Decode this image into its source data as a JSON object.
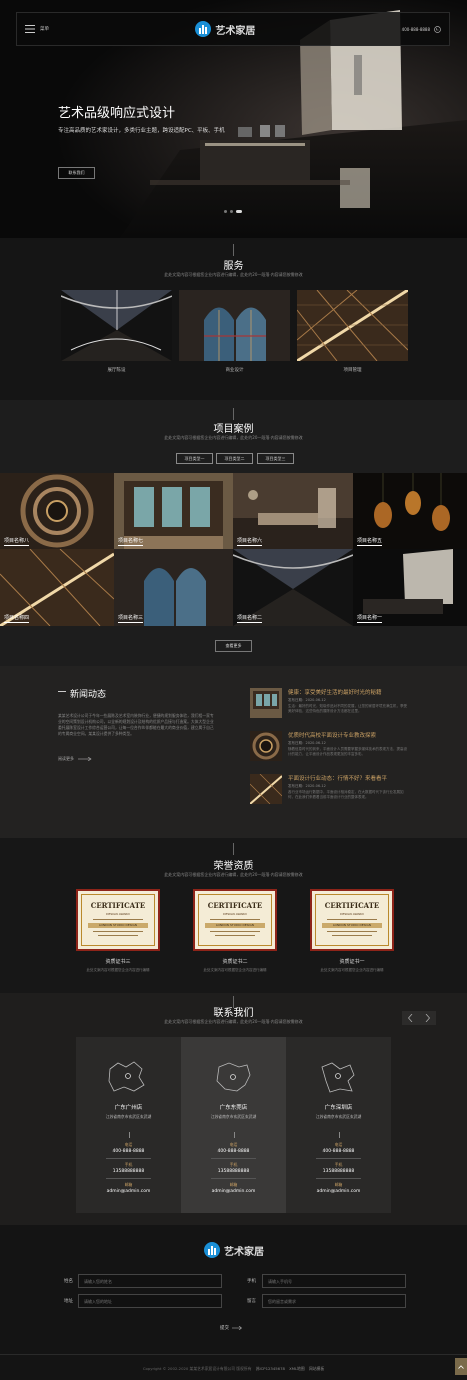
{
  "header": {
    "menu_label": "菜单",
    "brand": "艺术家居",
    "phone": "400-888-8888"
  },
  "hero": {
    "title": "艺术品级响应式设计",
    "subtitle": "专注高品质的艺术家设计，多类行业主题，跨设适配PC、平板、手机",
    "button": "联系我们"
  },
  "services": {
    "title": "服务",
    "subtitle": "此处文案内容可根据您企业内容进行编辑，此处约20一段落·内容请您按需修改",
    "items": [
      {
        "label": "展厅陈设"
      },
      {
        "label": "商业设计"
      },
      {
        "label": "项目管理"
      }
    ]
  },
  "cases": {
    "title": "项目案例",
    "subtitle": "此处文案内容可根据您企业内容进行编辑，此处约20一段落·内容请您按需修改",
    "filters": [
      "项目类型一",
      "项目类型二",
      "项目类型三"
    ],
    "tiles": [
      "项目名称八",
      "项目名称七",
      "项目名称六",
      "项目名称五",
      "项目名称四",
      "项目名称三",
      "项目名称二",
      "项目名称一"
    ],
    "more": "查看更多"
  },
  "news": {
    "title": "新闻动态",
    "intro": "某某艺术设计公司于今年一些展陈及艺术室内装饰行业，便捷的规划服务体验，我们相一家专业的空间策划设计机构公司，以全新的规划设计及结构的优质产品接与打造案。大体大型企业委托展陈室设计工作综合运营公司，让每一位合作伙伴都能在最大的商业价值，建立属于自己的专属商业空间。某某设计提供了多种类型。",
    "more": "阅读更多",
    "items": [
      {
        "title": "健康：享受美好生活的最好时光的秘籍",
        "date": "发布日期：2020-06-12",
        "desc": "生活：最好的时光，知晓作品对不同的发展，让您的家居环境充满生机，享受美好体验，这些特色的展陈设计方法都在这里。"
      },
      {
        "title": "优质时代高校平面设计专业教改探索",
        "date": "发布日期：2020-06-12",
        "desc": "随着信息时代的到来，平面设计人员需要掌握多媒体技术的表现方法，提高设计的能力，让平面设计作品表现更加的丰富多彩。"
      },
      {
        "title": "平面设计行业动态：行情不好？来看看平",
        "date": "发布日期：2020-06-12",
        "desc": "各行业市场运行数据中，平面设计相对稳定，在大数据时代下该行业发展如何，在此我们来看看当前平面设计行业的整体表现。"
      }
    ]
  },
  "honors": {
    "title": "荣誉资质",
    "subtitle": "此处文案内容可根据您企业内容进行编辑，此处约20一段落·内容请您按需修改",
    "cert_heading": "CERTIFICATE",
    "cert_small": "DESIGN AWARD",
    "cert_band": "LONDON STUDIO DESIGN",
    "items": [
      {
        "label": "资质证书三",
        "desc": "此处文案内容可根据您企业内容进行编辑"
      },
      {
        "label": "资质证书二",
        "desc": "此处文案内容可根据您企业内容进行编辑"
      },
      {
        "label": "资质证书一",
        "desc": "此处文案内容可根据您企业内容进行编辑"
      }
    ]
  },
  "contact": {
    "title": "联系我们",
    "subtitle": "此处文案内容可根据您企业内容进行编辑，此处约20一段落·内容请您按需修改",
    "phone_k": "电话",
    "mobile_k": "手机",
    "email_k": "邮箱",
    "cols": [
      {
        "city": "广东广州店",
        "addr": "江苏省南京市玄武区玄武湖",
        "phone": "400-888-8888",
        "mobile": "13588888888",
        "email": "admin@admin.com"
      },
      {
        "city": "广东东莞店",
        "addr": "江苏省南京市玄武区玄武湖",
        "phone": "400-888-8888",
        "mobile": "13588888888",
        "email": "admin@admin.com"
      },
      {
        "city": "广东深圳店",
        "addr": "江苏省南京市玄武区玄武湖",
        "phone": "400-888-8888",
        "mobile": "13588888888",
        "email": "admin@admin.com"
      }
    ]
  },
  "form": {
    "brand": "艺术家居",
    "name_label": "姓名",
    "name_ph": "请输入您的姓名",
    "mobile_label": "手机",
    "mobile_ph": "请输入手机号",
    "addr_label": "地址",
    "addr_ph": "请输入您的地址",
    "msg_label": "留言",
    "msg_ph": "您的留言或需求",
    "submit": "提交"
  },
  "footer": {
    "copyright": "Copyright © 2002-2020 某某艺术家居设计有限公司 版权所有",
    "icp": "苏ICP12345678",
    "sitemap": "XML地图",
    "sitemap2": "网站模板"
  }
}
